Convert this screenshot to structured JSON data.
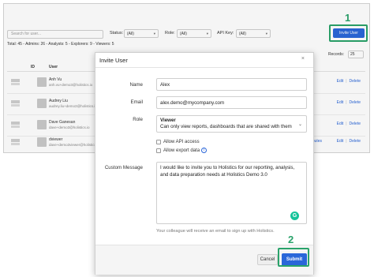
{
  "toolbar": {
    "search_placeholder": "Search for user...",
    "status_label": "Status:",
    "status_value": "(All)",
    "role_label": "Role:",
    "role_value": "(All)",
    "api_key_label": "API Key:",
    "api_key_value": "(All)",
    "invite_button": "Invite User",
    "totals": "Total: 45 - Admins: 26 - Analysts: 5 - Explorers: 9 - Viewers: 5",
    "records_label": "Records:",
    "records_value": "25"
  },
  "table": {
    "headers": [
      "ID",
      "User"
    ],
    "rows": [
      {
        "name": "Anh Vu",
        "email": "anh.vu+demo3@holistics.io",
        "edit": "Edit",
        "delete": "Delete"
      },
      {
        "name": "Audrey Liu",
        "email": "audrey.liu+demo3@holistics.io",
        "edit": "Edit",
        "delete": "Delete"
      },
      {
        "name": "Dave Ganesan",
        "email": "dave+demo3@holistics.io",
        "edit": "Edit",
        "delete": "Delete"
      },
      {
        "name": "dviewer",
        "email": "dave+demo3viewer@holistics.io",
        "attributes": "ributes",
        "edit": "Edit",
        "delete": "Delete"
      }
    ]
  },
  "steps": {
    "one": "1",
    "two": "2"
  },
  "modal": {
    "title": "Invite User",
    "close": "×",
    "name_label": "Name",
    "name_value": "Alex",
    "email_label": "Email",
    "email_value": "alex.demo@mycompany.com",
    "role_label": "Role",
    "role_value": "Viewer",
    "role_description": "Can only view reports, dashboards that are shared with them",
    "allow_api": "Allow API access",
    "allow_export": "Allow export data",
    "custom_message_label": "Custom Message",
    "custom_message_value": "I would like to invite you to Holistics for our reporting, analysis, and data preparation needs at Holistics Demo 3.0",
    "hint": "Your colleague will receive an email to sign up with Holistics.",
    "cancel": "Cancel",
    "submit": "Submit"
  },
  "icons": {
    "info": "i",
    "grammarly": "G",
    "chevron": "⌄"
  },
  "colors": {
    "accent": "#2a66d9",
    "highlight": "#2aa36b"
  }
}
